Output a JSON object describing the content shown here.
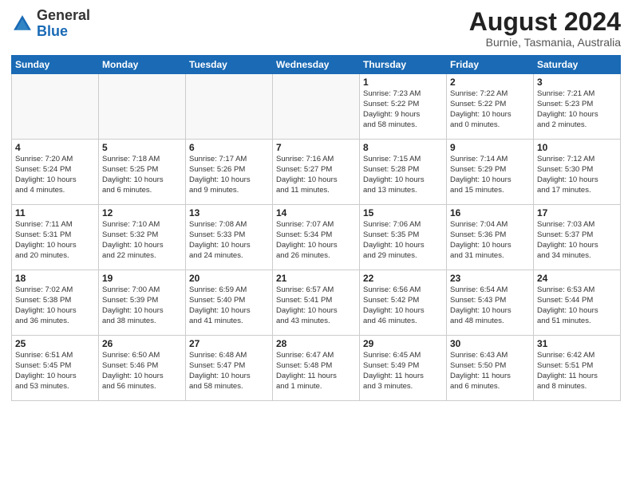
{
  "header": {
    "logo_general": "General",
    "logo_blue": "Blue",
    "month_year": "August 2024",
    "location": "Burnie, Tasmania, Australia"
  },
  "days_of_week": [
    "Sunday",
    "Monday",
    "Tuesday",
    "Wednesday",
    "Thursday",
    "Friday",
    "Saturday"
  ],
  "weeks": [
    [
      {
        "day": "",
        "info": ""
      },
      {
        "day": "",
        "info": ""
      },
      {
        "day": "",
        "info": ""
      },
      {
        "day": "",
        "info": ""
      },
      {
        "day": "1",
        "info": "Sunrise: 7:23 AM\nSunset: 5:22 PM\nDaylight: 9 hours\nand 58 minutes."
      },
      {
        "day": "2",
        "info": "Sunrise: 7:22 AM\nSunset: 5:22 PM\nDaylight: 10 hours\nand 0 minutes."
      },
      {
        "day": "3",
        "info": "Sunrise: 7:21 AM\nSunset: 5:23 PM\nDaylight: 10 hours\nand 2 minutes."
      }
    ],
    [
      {
        "day": "4",
        "info": "Sunrise: 7:20 AM\nSunset: 5:24 PM\nDaylight: 10 hours\nand 4 minutes."
      },
      {
        "day": "5",
        "info": "Sunrise: 7:18 AM\nSunset: 5:25 PM\nDaylight: 10 hours\nand 6 minutes."
      },
      {
        "day": "6",
        "info": "Sunrise: 7:17 AM\nSunset: 5:26 PM\nDaylight: 10 hours\nand 9 minutes."
      },
      {
        "day": "7",
        "info": "Sunrise: 7:16 AM\nSunset: 5:27 PM\nDaylight: 10 hours\nand 11 minutes."
      },
      {
        "day": "8",
        "info": "Sunrise: 7:15 AM\nSunset: 5:28 PM\nDaylight: 10 hours\nand 13 minutes."
      },
      {
        "day": "9",
        "info": "Sunrise: 7:14 AM\nSunset: 5:29 PM\nDaylight: 10 hours\nand 15 minutes."
      },
      {
        "day": "10",
        "info": "Sunrise: 7:12 AM\nSunset: 5:30 PM\nDaylight: 10 hours\nand 17 minutes."
      }
    ],
    [
      {
        "day": "11",
        "info": "Sunrise: 7:11 AM\nSunset: 5:31 PM\nDaylight: 10 hours\nand 20 minutes."
      },
      {
        "day": "12",
        "info": "Sunrise: 7:10 AM\nSunset: 5:32 PM\nDaylight: 10 hours\nand 22 minutes."
      },
      {
        "day": "13",
        "info": "Sunrise: 7:08 AM\nSunset: 5:33 PM\nDaylight: 10 hours\nand 24 minutes."
      },
      {
        "day": "14",
        "info": "Sunrise: 7:07 AM\nSunset: 5:34 PM\nDaylight: 10 hours\nand 26 minutes."
      },
      {
        "day": "15",
        "info": "Sunrise: 7:06 AM\nSunset: 5:35 PM\nDaylight: 10 hours\nand 29 minutes."
      },
      {
        "day": "16",
        "info": "Sunrise: 7:04 AM\nSunset: 5:36 PM\nDaylight: 10 hours\nand 31 minutes."
      },
      {
        "day": "17",
        "info": "Sunrise: 7:03 AM\nSunset: 5:37 PM\nDaylight: 10 hours\nand 34 minutes."
      }
    ],
    [
      {
        "day": "18",
        "info": "Sunrise: 7:02 AM\nSunset: 5:38 PM\nDaylight: 10 hours\nand 36 minutes."
      },
      {
        "day": "19",
        "info": "Sunrise: 7:00 AM\nSunset: 5:39 PM\nDaylight: 10 hours\nand 38 minutes."
      },
      {
        "day": "20",
        "info": "Sunrise: 6:59 AM\nSunset: 5:40 PM\nDaylight: 10 hours\nand 41 minutes."
      },
      {
        "day": "21",
        "info": "Sunrise: 6:57 AM\nSunset: 5:41 PM\nDaylight: 10 hours\nand 43 minutes."
      },
      {
        "day": "22",
        "info": "Sunrise: 6:56 AM\nSunset: 5:42 PM\nDaylight: 10 hours\nand 46 minutes."
      },
      {
        "day": "23",
        "info": "Sunrise: 6:54 AM\nSunset: 5:43 PM\nDaylight: 10 hours\nand 48 minutes."
      },
      {
        "day": "24",
        "info": "Sunrise: 6:53 AM\nSunset: 5:44 PM\nDaylight: 10 hours\nand 51 minutes."
      }
    ],
    [
      {
        "day": "25",
        "info": "Sunrise: 6:51 AM\nSunset: 5:45 PM\nDaylight: 10 hours\nand 53 minutes."
      },
      {
        "day": "26",
        "info": "Sunrise: 6:50 AM\nSunset: 5:46 PM\nDaylight: 10 hours\nand 56 minutes."
      },
      {
        "day": "27",
        "info": "Sunrise: 6:48 AM\nSunset: 5:47 PM\nDaylight: 10 hours\nand 58 minutes."
      },
      {
        "day": "28",
        "info": "Sunrise: 6:47 AM\nSunset: 5:48 PM\nDaylight: 11 hours\nand 1 minute."
      },
      {
        "day": "29",
        "info": "Sunrise: 6:45 AM\nSunset: 5:49 PM\nDaylight: 11 hours\nand 3 minutes."
      },
      {
        "day": "30",
        "info": "Sunrise: 6:43 AM\nSunset: 5:50 PM\nDaylight: 11 hours\nand 6 minutes."
      },
      {
        "day": "31",
        "info": "Sunrise: 6:42 AM\nSunset: 5:51 PM\nDaylight: 11 hours\nand 8 minutes."
      }
    ]
  ]
}
